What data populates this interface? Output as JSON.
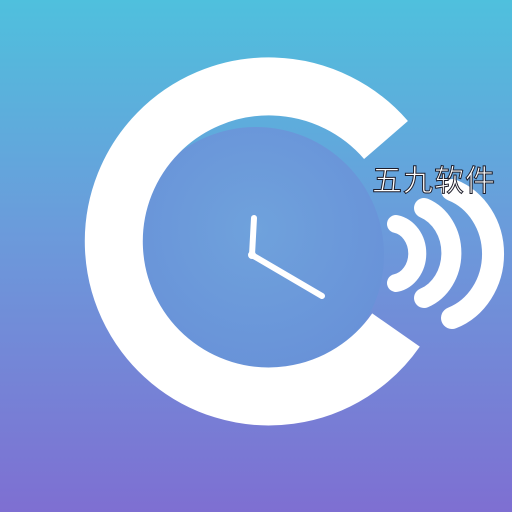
{
  "icon": {
    "watermark_text": "五九软件",
    "symbol": "clock-with-sound-waves",
    "colors": {
      "gradient_top": "#4fc0dd",
      "gradient_mid": "#6b9bdb",
      "gradient_bottom": "#7e6fd2",
      "ring": "#ffffff",
      "clock_face": "#6b9ddb",
      "hands": "#ffffff"
    }
  }
}
